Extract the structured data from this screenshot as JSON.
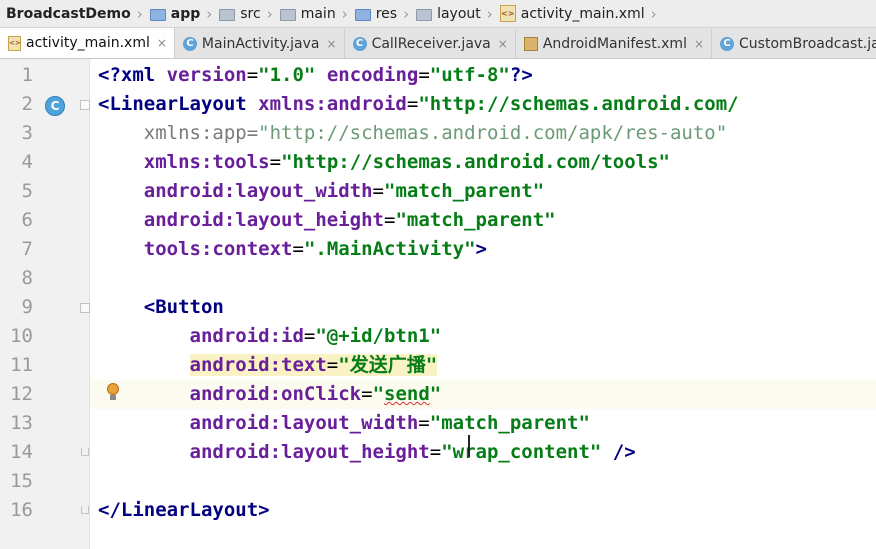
{
  "breadcrumb": {
    "items": [
      {
        "label": "BroadcastDemo",
        "icon": "none"
      },
      {
        "label": "app",
        "icon": "module-folder-icon"
      },
      {
        "label": "src",
        "icon": "folder-icon"
      },
      {
        "label": "main",
        "icon": "folder-icon"
      },
      {
        "label": "res",
        "icon": "res-folder-icon"
      },
      {
        "label": "layout",
        "icon": "folder-icon"
      },
      {
        "label": "activity_main.xml",
        "icon": "xml-file-icon"
      }
    ],
    "separator": "›"
  },
  "tabs": [
    {
      "label": "activity_main.xml",
      "icon": "xml-file-icon",
      "active": true
    },
    {
      "label": "MainActivity.java",
      "icon": "class-icon",
      "active": false
    },
    {
      "label": "CallReceiver.java",
      "icon": "class-icon",
      "active": false
    },
    {
      "label": "AndroidManifest.xml",
      "icon": "manifest-icon",
      "active": false
    },
    {
      "label": "CustomBroadcast.java",
      "icon": "class-icon",
      "active": false
    }
  ],
  "tab_close_glyph": "×",
  "editor": {
    "gutter_markers": {
      "class_marker": "C"
    },
    "lines": [
      {
        "n": "1",
        "parts": [
          {
            "t": "<?xml ",
            "c": "t-tag"
          },
          {
            "t": "version",
            "c": "t-attr"
          },
          {
            "t": "=",
            "c": "t-punct"
          },
          {
            "t": "\"1.0\"",
            "c": "t-val"
          },
          {
            "t": " ",
            "c": "t-punct"
          },
          {
            "t": "encoding",
            "c": "t-attr"
          },
          {
            "t": "=",
            "c": "t-punct"
          },
          {
            "t": "\"utf-8\"",
            "c": "t-val"
          },
          {
            "t": "?>",
            "c": "t-tag"
          }
        ]
      },
      {
        "n": "2",
        "parts": [
          {
            "t": "<LinearLayout ",
            "c": "t-tag"
          },
          {
            "t": "xmlns:android",
            "c": "t-attr"
          },
          {
            "t": "=",
            "c": "t-punct"
          },
          {
            "t": "\"http://schemas.android.com/",
            "c": "t-val"
          }
        ]
      },
      {
        "n": "3",
        "parts": [
          {
            "t": "    ",
            "c": "t-punct"
          },
          {
            "t": "xmlns:app",
            "c": "t-attr-dim"
          },
          {
            "t": "=",
            "c": "t-attr-dim"
          },
          {
            "t": "\"http://schemas.android.com/apk/res-auto\"",
            "c": "t-val-dim"
          }
        ]
      },
      {
        "n": "4",
        "parts": [
          {
            "t": "    ",
            "c": "t-punct"
          },
          {
            "t": "xmlns:tools",
            "c": "t-attr"
          },
          {
            "t": "=",
            "c": "t-punct"
          },
          {
            "t": "\"http://schemas.android.com/tools\"",
            "c": "t-val"
          }
        ]
      },
      {
        "n": "5",
        "parts": [
          {
            "t": "    ",
            "c": "t-punct"
          },
          {
            "t": "android:layout_width",
            "c": "t-attr"
          },
          {
            "t": "=",
            "c": "t-punct"
          },
          {
            "t": "\"match_parent\"",
            "c": "t-val"
          }
        ]
      },
      {
        "n": "6",
        "parts": [
          {
            "t": "    ",
            "c": "t-punct"
          },
          {
            "t": "android:layout_height",
            "c": "t-attr"
          },
          {
            "t": "=",
            "c": "t-punct"
          },
          {
            "t": "\"match_parent\"",
            "c": "t-val"
          }
        ]
      },
      {
        "n": "7",
        "parts": [
          {
            "t": "    ",
            "c": "t-punct"
          },
          {
            "t": "tools:context",
            "c": "t-attr"
          },
          {
            "t": "=",
            "c": "t-punct"
          },
          {
            "t": "\".MainActivity\"",
            "c": "t-val"
          },
          {
            "t": ">",
            "c": "t-tag"
          }
        ]
      },
      {
        "n": "8",
        "parts": []
      },
      {
        "n": "9",
        "parts": [
          {
            "t": "    ",
            "c": "t-punct"
          },
          {
            "t": "<Button",
            "c": "t-tag"
          }
        ]
      },
      {
        "n": "10",
        "parts": [
          {
            "t": "        ",
            "c": "t-punct"
          },
          {
            "t": "android:id",
            "c": "t-attr"
          },
          {
            "t": "=",
            "c": "t-punct"
          },
          {
            "t": "\"@+id/btn1\"",
            "c": "t-val"
          }
        ]
      },
      {
        "n": "11",
        "parts": [
          {
            "t": "        ",
            "c": "t-punct"
          },
          {
            "t": "android:text",
            "c": "t-attr hl"
          },
          {
            "t": "=",
            "c": "t-punct hl"
          },
          {
            "t": "\"发送广播\"",
            "c": "t-val hl"
          }
        ]
      },
      {
        "n": "12",
        "parts": [
          {
            "t": "        ",
            "c": "t-punct"
          },
          {
            "t": "android:onClick",
            "c": "t-attr"
          },
          {
            "t": "=",
            "c": "t-punct"
          },
          {
            "t": "\"",
            "c": "t-val"
          },
          {
            "t": "send",
            "c": "t-val typo"
          },
          {
            "t": "\"",
            "c": "t-val"
          }
        ]
      },
      {
        "n": "13",
        "parts": [
          {
            "t": "        ",
            "c": "t-punct"
          },
          {
            "t": "android:layout_width",
            "c": "t-attr"
          },
          {
            "t": "=",
            "c": "t-punct"
          },
          {
            "t": "\"match_parent\"",
            "c": "t-val"
          }
        ]
      },
      {
        "n": "14",
        "parts": [
          {
            "t": "        ",
            "c": "t-punct"
          },
          {
            "t": "android:layout_height",
            "c": "t-attr"
          },
          {
            "t": "=",
            "c": "t-punct"
          },
          {
            "t": "\"wrap_content\"",
            "c": "t-val"
          },
          {
            "t": " />",
            "c": "t-tag"
          }
        ]
      },
      {
        "n": "15",
        "parts": []
      },
      {
        "n": "16",
        "parts": [
          {
            "t": "</LinearLayout>",
            "c": "t-tag"
          }
        ]
      }
    ]
  },
  "colors": {
    "tag": "#000080",
    "attribute": "#6a1f9a",
    "value": "#067d17",
    "line_number": "#9a9a9a",
    "highlight": "#f8f2c4"
  }
}
